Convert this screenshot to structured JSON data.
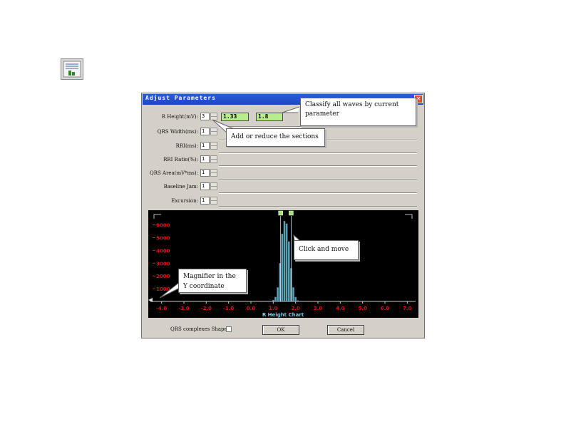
{
  "dialog": {
    "title": "Adjust Parameters",
    "close_label": "×",
    "params": [
      {
        "label": "R Height(mV):",
        "value": "3"
      },
      {
        "label": "QRS Width(ms):",
        "value": "1"
      },
      {
        "label": "RRI(ms):",
        "value": "1"
      },
      {
        "label": "RRI Ratio(%):",
        "value": "1"
      },
      {
        "label": "QRS Area(mV*ms):",
        "value": "1"
      },
      {
        "label": "Baseline Jam:",
        "value": "1"
      },
      {
        "label": "Excursion:",
        "value": "1"
      }
    ],
    "range_low": "1.33",
    "range_high": "1.8",
    "qrs_shape_label": "QRS complexes Shape:",
    "ok_label": "OK",
    "cancel_label": "Cancel"
  },
  "callouts": {
    "classify": "Classify all waves by current parameter",
    "sections": "Add or reduce the sections",
    "click_move": "Click and move",
    "magnifier": "Magnifier in the Y coordinate"
  },
  "colors": {
    "accent": "#1c47c2",
    "range_box": "#b8ee8a",
    "histogram": "#5aa0b4",
    "axis_labels": "#e01010",
    "chart_title": "#7fc8e0"
  },
  "chart_data": {
    "type": "bar",
    "title": "R Height Chart",
    "x_ticks": [
      "-4.0",
      "-3.0",
      "-2.0",
      "-1.0",
      "0.0",
      "1.0",
      "2.0",
      "3.0",
      "4.0",
      "5.0",
      "6.0",
      "7.0"
    ],
    "y_ticks": [
      "1000",
      "2000",
      "3000",
      "4000",
      "5000",
      "6000"
    ],
    "xlim": [
      -4.5,
      7.5
    ],
    "ylim": [
      0,
      6700
    ],
    "x": [
      0.9,
      1.0,
      1.1,
      1.2,
      1.3,
      1.4,
      1.5,
      1.6,
      1.7,
      1.8,
      1.9,
      2.0,
      2.1
    ],
    "values": [
      40,
      120,
      350,
      1100,
      3000,
      5300,
      6300,
      6100,
      4700,
      2600,
      1100,
      350,
      80
    ],
    "markers": [
      1.33,
      1.8
    ]
  }
}
